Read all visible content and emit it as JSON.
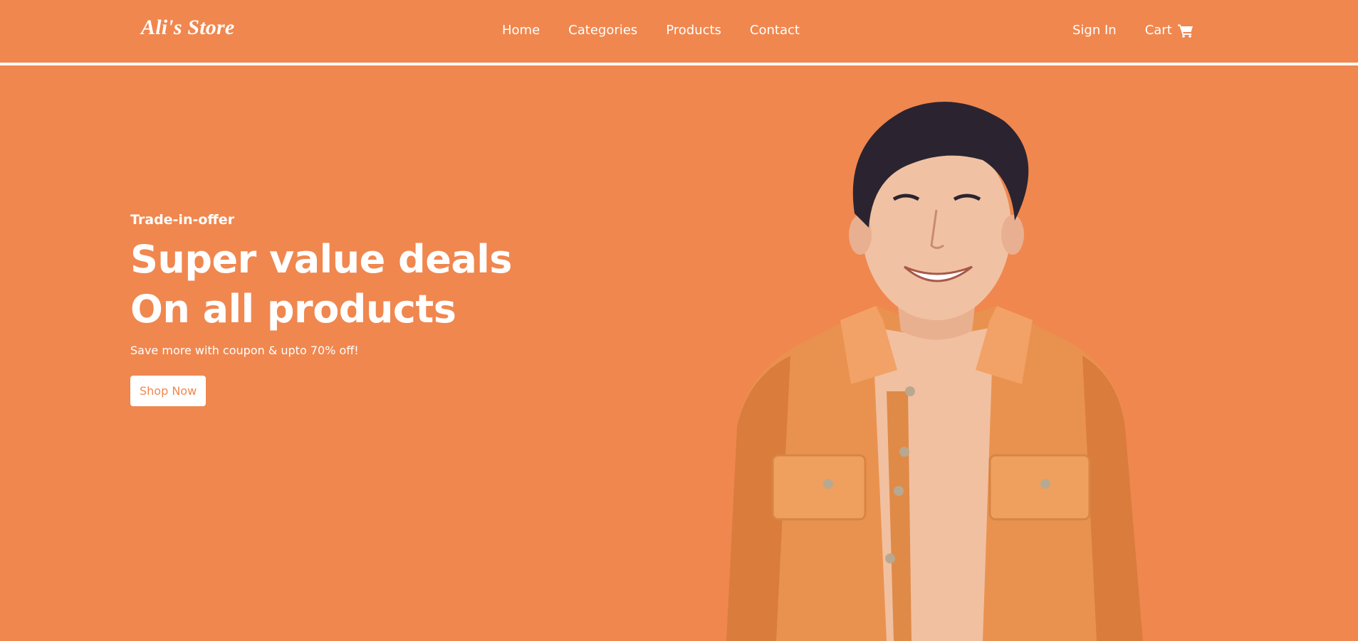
{
  "brand": {
    "name": "Ali's Store"
  },
  "nav": {
    "items": [
      {
        "label": "Home"
      },
      {
        "label": "Categories"
      },
      {
        "label": "Products"
      },
      {
        "label": "Contact"
      }
    ]
  },
  "auth": {
    "sign_in_label": "Sign In",
    "cart_label": "Cart",
    "cart_icon": "shopping-cart-icon"
  },
  "hero": {
    "eyebrow": "Trade-in-offer",
    "headline_line1": "Super value deals",
    "headline_line2": "On all products",
    "subtext": "Save more with coupon & upto 70% off!",
    "cta_label": "Shop Now",
    "image": "smiling-man-in-orange-denim-jacket"
  },
  "colors": {
    "background": "#F0874F",
    "text": "#FFFFFF",
    "button_bg": "#FFFFFF",
    "button_text": "#F0874F"
  }
}
